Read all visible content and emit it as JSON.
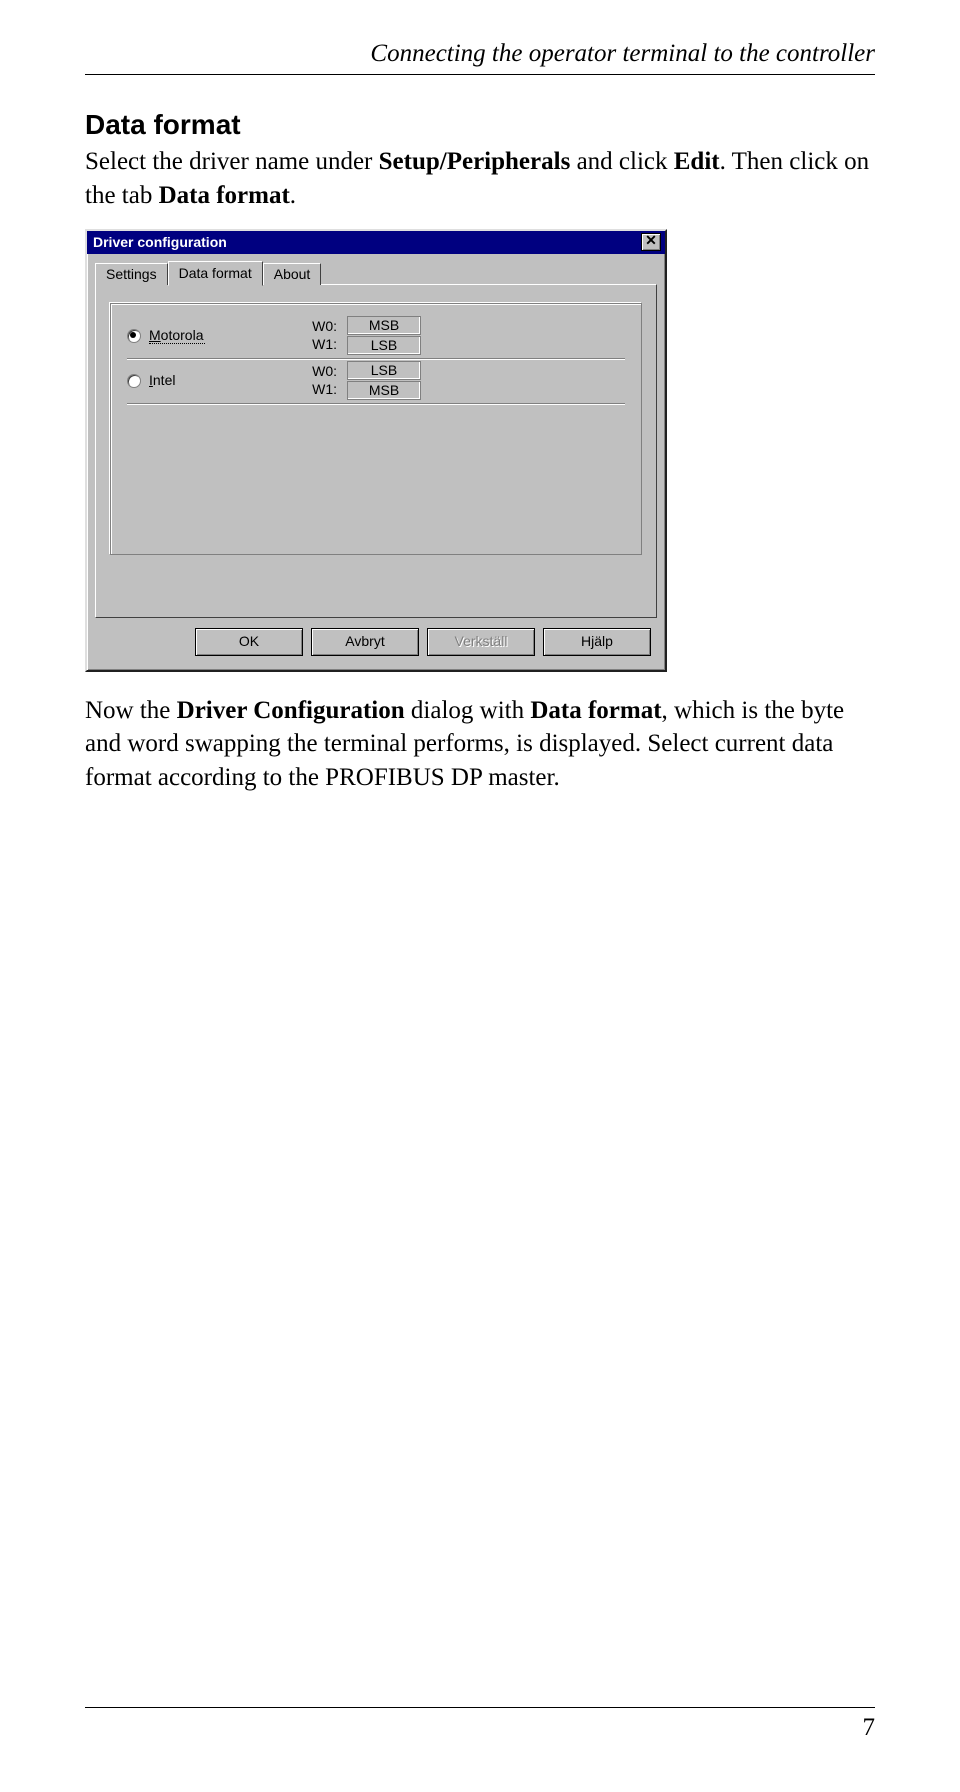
{
  "page": {
    "running_title": "Connecting the operator terminal to the controller",
    "page_number": "7"
  },
  "heading": "Data format",
  "para1": {
    "pre": "Select the driver name under ",
    "b1": "Setup/Peripherals",
    "mid1": " and click ",
    "b2": "Edit",
    "mid2": ". Then click on the tab ",
    "b3": "Data format",
    "post": "."
  },
  "dialog": {
    "title": "Driver configuration",
    "close_glyph": "✕",
    "tabs": {
      "settings": "Settings",
      "dataformat": "Data format",
      "about": "About"
    },
    "options": [
      {
        "label_prefix": "M",
        "label_rest": "otorola",
        "checked": true,
        "focused": true,
        "w0_label": "W0:",
        "w1_label": "W1:",
        "w0": "MSB",
        "w1": "LSB"
      },
      {
        "label_prefix": "I",
        "label_rest": "ntel",
        "checked": false,
        "focused": false,
        "w0_label": "W0:",
        "w1_label": "W1:",
        "w0": "LSB",
        "w1": "MSB"
      }
    ],
    "buttons": {
      "ok": "OK",
      "cancel": "Avbryt",
      "apply": "Verkställ",
      "help": "Hjälp"
    }
  },
  "para2": {
    "pre": "Now the ",
    "b1": "Driver Configuration",
    "mid1": " dialog with ",
    "b2": "Data format",
    "post": ", which is the byte and word swapping the terminal performs, is displayed. Select current data format according to the PROFIBUS DP master."
  }
}
